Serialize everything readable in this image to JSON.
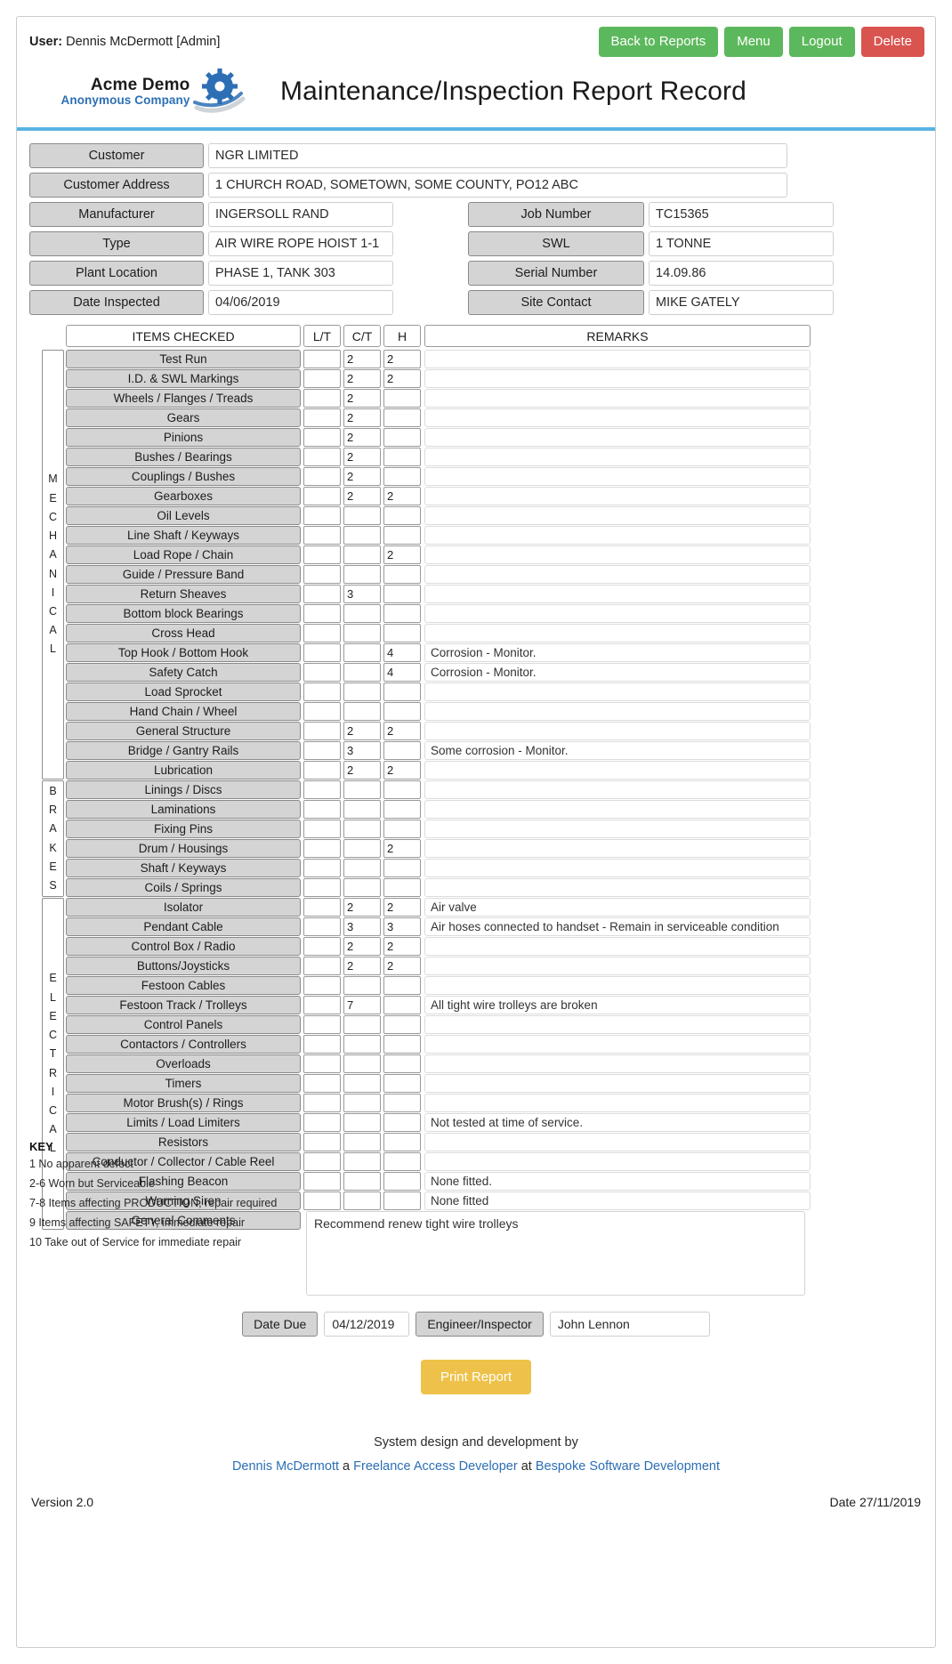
{
  "topbar": {
    "user_label": "User:",
    "user_name": "Dennis McDermott [Admin]",
    "back_label": "Back to Reports",
    "menu_label": "Menu",
    "logout_label": "Logout",
    "delete_label": "Delete",
    "green": "#5cb85c",
    "red": "#d9534f"
  },
  "header": {
    "logo_line1": "Acme Demo",
    "logo_line2": "Anonymous Company",
    "title": "Maintenance/Inspection Report Record",
    "accent": "#5bb3e4"
  },
  "form": {
    "customer_label": "Customer",
    "customer_value": "NGR LIMITED",
    "address_label": "Customer Address",
    "address_value": "1 CHURCH ROAD, SOMETOWN, SOME COUNTY, PO12 ABC",
    "manufacturer_label": "Manufacturer",
    "manufacturer_value": "INGERSOLL RAND",
    "job_label": "Job Number",
    "job_value": "TC15365",
    "type_label": "Type",
    "type_value": "AIR WIRE ROPE HOIST 1-1",
    "swl_label": "SWL",
    "swl_value": "1 TONNE",
    "plant_label": "Plant Location",
    "plant_value": "PHASE 1, TANK 303",
    "serial_label": "Serial Number",
    "serial_value": "14.09.86",
    "date_label": "Date Inspected",
    "date_value": "04/06/2019",
    "contact_label": "Site Contact",
    "contact_value": "MIKE GATELY"
  },
  "table": {
    "headers": {
      "items": "ITEMS CHECKED",
      "lt": "L/T",
      "ct": "C/T",
      "h": "H",
      "remarks": "REMARKS"
    },
    "sections": [
      {
        "name": "MECHANICAL",
        "letters": "MECHANICAL",
        "start": 0,
        "count": 22
      },
      {
        "name": "BRAKES",
        "letters": "BRAKES",
        "start": 22,
        "count": 6
      },
      {
        "name": "ELECTRICAL",
        "letters": "ELECTRICAL",
        "start": 28,
        "count": 17
      }
    ],
    "rows": [
      {
        "item": "Test Run",
        "lt": "",
        "ct": "2",
        "h": "2",
        "remarks": ""
      },
      {
        "item": "I.D. & SWL Markings",
        "lt": "",
        "ct": "2",
        "h": "2",
        "remarks": ""
      },
      {
        "item": "Wheels / Flanges / Treads",
        "lt": "",
        "ct": "2",
        "h": "",
        "remarks": ""
      },
      {
        "item": "Gears",
        "lt": "",
        "ct": "2",
        "h": "",
        "remarks": ""
      },
      {
        "item": "Pinions",
        "lt": "",
        "ct": "2",
        "h": "",
        "remarks": ""
      },
      {
        "item": "Bushes / Bearings",
        "lt": "",
        "ct": "2",
        "h": "",
        "remarks": ""
      },
      {
        "item": "Couplings / Bushes",
        "lt": "",
        "ct": "2",
        "h": "",
        "remarks": ""
      },
      {
        "item": "Gearboxes",
        "lt": "",
        "ct": "2",
        "h": "2",
        "remarks": ""
      },
      {
        "item": "Oil Levels",
        "lt": "",
        "ct": "",
        "h": "",
        "remarks": ""
      },
      {
        "item": "Line Shaft / Keyways",
        "lt": "",
        "ct": "",
        "h": "",
        "remarks": ""
      },
      {
        "item": "Load Rope / Chain",
        "lt": "",
        "ct": "",
        "h": "2",
        "remarks": ""
      },
      {
        "item": "Guide / Pressure Band",
        "lt": "",
        "ct": "",
        "h": "",
        "remarks": ""
      },
      {
        "item": "Return Sheaves",
        "lt": "",
        "ct": "3",
        "h": "",
        "remarks": ""
      },
      {
        "item": "Bottom block Bearings",
        "lt": "",
        "ct": "",
        "h": "",
        "remarks": ""
      },
      {
        "item": "Cross Head",
        "lt": "",
        "ct": "",
        "h": "",
        "remarks": ""
      },
      {
        "item": "Top Hook / Bottom Hook",
        "lt": "",
        "ct": "",
        "h": "4",
        "remarks": "Corrosion - Monitor."
      },
      {
        "item": "Safety Catch",
        "lt": "",
        "ct": "",
        "h": "4",
        "remarks": "Corrosion - Monitor."
      },
      {
        "item": "Load Sprocket",
        "lt": "",
        "ct": "",
        "h": "",
        "remarks": ""
      },
      {
        "item": "Hand Chain / Wheel",
        "lt": "",
        "ct": "",
        "h": "",
        "remarks": ""
      },
      {
        "item": "General Structure",
        "lt": "",
        "ct": "2",
        "h": "2",
        "remarks": ""
      },
      {
        "item": "Bridge / Gantry Rails",
        "lt": "",
        "ct": "3",
        "h": "",
        "remarks": "Some corrosion -  Monitor."
      },
      {
        "item": "Lubrication",
        "lt": "",
        "ct": "2",
        "h": "2",
        "remarks": ""
      },
      {
        "item": "Linings / Discs",
        "lt": "",
        "ct": "",
        "h": "",
        "remarks": ""
      },
      {
        "item": "Laminations",
        "lt": "",
        "ct": "",
        "h": "",
        "remarks": ""
      },
      {
        "item": "Fixing Pins",
        "lt": "",
        "ct": "",
        "h": "",
        "remarks": ""
      },
      {
        "item": "Drum / Housings",
        "lt": "",
        "ct": "",
        "h": "2",
        "remarks": ""
      },
      {
        "item": "Shaft / Keyways",
        "lt": "",
        "ct": "",
        "h": "",
        "remarks": ""
      },
      {
        "item": "Coils / Springs",
        "lt": "",
        "ct": "",
        "h": "",
        "remarks": ""
      },
      {
        "item": "Isolator",
        "lt": "",
        "ct": "2",
        "h": "2",
        "remarks": "Air valve"
      },
      {
        "item": "Pendant Cable",
        "lt": "",
        "ct": "3",
        "h": "3",
        "remarks": "Air hoses connected to handset - Remain in serviceable condition"
      },
      {
        "item": "Control Box / Radio",
        "lt": "",
        "ct": "2",
        "h": "2",
        "remarks": ""
      },
      {
        "item": "Buttons/Joysticks",
        "lt": "",
        "ct": "2",
        "h": "2",
        "remarks": ""
      },
      {
        "item": "Festoon Cables",
        "lt": "",
        "ct": "",
        "h": "",
        "remarks": ""
      },
      {
        "item": "Festoon Track / Trolleys",
        "lt": "",
        "ct": "7",
        "h": "",
        "remarks": "All tight wire trolleys are broken"
      },
      {
        "item": "Control Panels",
        "lt": "",
        "ct": "",
        "h": "",
        "remarks": ""
      },
      {
        "item": "Contactors / Controllers",
        "lt": "",
        "ct": "",
        "h": "",
        "remarks": ""
      },
      {
        "item": "Overloads",
        "lt": "",
        "ct": "",
        "h": "",
        "remarks": ""
      },
      {
        "item": "Timers",
        "lt": "",
        "ct": "",
        "h": "",
        "remarks": ""
      },
      {
        "item": "Motor Brush(s) / Rings",
        "lt": "",
        "ct": "",
        "h": "",
        "remarks": ""
      },
      {
        "item": "Limits / Load Limiters",
        "lt": "",
        "ct": "",
        "h": "",
        "remarks": "Not tested at time of service."
      },
      {
        "item": "Resistors",
        "lt": "",
        "ct": "",
        "h": "",
        "remarks": ""
      },
      {
        "item": "Conductor / Collector / Cable Reel",
        "lt": "",
        "ct": "",
        "h": "",
        "remarks": ""
      },
      {
        "item": "Flashing Beacon",
        "lt": "",
        "ct": "",
        "h": "",
        "remarks": "None fitted."
      },
      {
        "item": "Warning Siren",
        "lt": "",
        "ct": "",
        "h": "",
        "remarks": "None fitted"
      }
    ]
  },
  "general_comments": {
    "label": "General Comments",
    "value": "Recommend renew tight wire trolleys"
  },
  "key": {
    "title": "KEY",
    "lines": [
      "1 No apparent defect",
      "2-6 Worn but Serviceable",
      "7-8 Items affecting PRODUCTION, repair required",
      "9 Items affecting SAFETY, immediate repair",
      "10 Take out of Service for immediate repair"
    ]
  },
  "footer_controls": {
    "date_due_label": "Date Due",
    "date_due_value": "04/12/2019",
    "engineer_label": "Engineer/Inspector",
    "engineer_value": "John Lennon",
    "print_label": "Print Report",
    "print_color": "#eec24a"
  },
  "credits": {
    "line1": "System design and development by",
    "name": "Dennis McDermott",
    "mid1": " a ",
    "role": "Freelance Access Developer",
    "mid2": " at ",
    "company": "Bespoke Software Development",
    "link_color": "#2c6fb5"
  },
  "bottom": {
    "version": "Version 2.0",
    "date": "Date 27/11/2019"
  }
}
